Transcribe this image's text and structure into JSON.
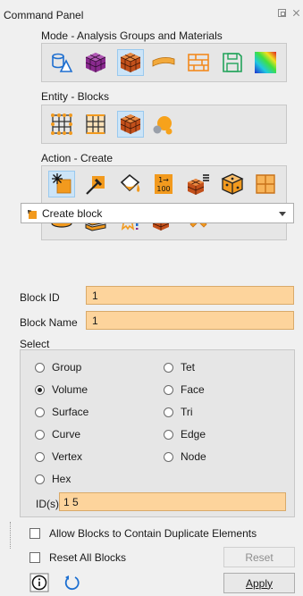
{
  "window": {
    "title": "Command Panel"
  },
  "mode": {
    "label": "Mode - Analysis Groups and Materials",
    "tools": [
      {
        "name": "geometry",
        "icon": "geometry-mode-icon",
        "selected": false
      },
      {
        "name": "mesh",
        "icon": "mesh-mode-icon",
        "selected": false
      },
      {
        "name": "blocks",
        "icon": "blocks-mode-icon",
        "selected": true
      },
      {
        "name": "boundary-conditions",
        "icon": "boundary-conditions-mode-icon",
        "selected": false
      },
      {
        "name": "materials",
        "icon": "materials-mode-icon",
        "selected": false
      },
      {
        "name": "export",
        "icon": "export-mode-icon",
        "selected": false
      },
      {
        "name": "results",
        "icon": "results-colormap-icon",
        "selected": false
      }
    ]
  },
  "entity": {
    "label": "Entity - Blocks",
    "tools": [
      {
        "name": "nodesets",
        "icon": "nodesets-icon",
        "selected": false
      },
      {
        "name": "sidesets",
        "icon": "sidesets-icon",
        "selected": false
      },
      {
        "name": "blocks",
        "icon": "blocks-entity-icon",
        "selected": true
      },
      {
        "name": "groups",
        "icon": "groups-icon",
        "selected": false
      }
    ]
  },
  "action": {
    "label": "Action - Create",
    "row1": [
      {
        "name": "create",
        "icon": "create-block-icon",
        "selected": true
      },
      {
        "name": "modify",
        "icon": "modify-block-icon",
        "selected": false
      },
      {
        "name": "element-type",
        "icon": "element-type-icon",
        "selected": false
      },
      {
        "name": "renumber",
        "icon": "renumber-icon",
        "selected": false,
        "glyph_top": "1→",
        "glyph_bottom": "100"
      },
      {
        "name": "list",
        "icon": "list-blocks-icon",
        "selected": false
      },
      {
        "name": "attributes",
        "icon": "block-attributes-icon",
        "selected": false
      },
      {
        "name": "split",
        "icon": "split-block-icon",
        "selected": false
      }
    ],
    "row2": [
      {
        "name": "cylinder",
        "icon": "cylinder-block-icon",
        "selected": false
      },
      {
        "name": "layers",
        "icon": "layered-block-icon",
        "selected": false
      },
      {
        "name": "properties",
        "icon": "block-properties-icon",
        "selected": false
      },
      {
        "name": "import",
        "icon": "import-block-icon",
        "selected": false
      },
      {
        "name": "delete",
        "icon": "delete-block-icon",
        "selected": false
      }
    ]
  },
  "command": {
    "selected": "Create block"
  },
  "fields": {
    "block_id": {
      "label": "Block ID",
      "value": "1"
    },
    "block_name": {
      "label": "Block Name",
      "value": "1"
    }
  },
  "select": {
    "label": "Select",
    "options_left": [
      {
        "label": "Group",
        "checked": false
      },
      {
        "label": "Volume",
        "checked": true
      },
      {
        "label": "Surface",
        "checked": false
      },
      {
        "label": "Curve",
        "checked": false
      },
      {
        "label": "Vertex",
        "checked": false
      },
      {
        "label": "Hex",
        "checked": false
      }
    ],
    "options_right": [
      {
        "label": "Tet",
        "checked": false
      },
      {
        "label": "Face",
        "checked": false
      },
      {
        "label": "Tri",
        "checked": false
      },
      {
        "label": "Edge",
        "checked": false
      },
      {
        "label": "Node",
        "checked": false
      }
    ],
    "ids_label": "ID(s)",
    "ids_value": "1 5"
  },
  "checkboxes": {
    "allow_duplicates": {
      "label": "Allow Blocks to Contain Duplicate Elements",
      "checked": false
    },
    "reset_all": {
      "label": "Reset All Blocks",
      "checked": false
    }
  },
  "buttons": {
    "reset": "Reset",
    "apply": "Apply"
  },
  "colors": {
    "accent_orange": "#fdd49c",
    "selection_blue": "#cce4f7",
    "panel_bg": "#f0f0f0",
    "group_bg": "#e6e6e6",
    "info_blue": "#1c6fd1"
  }
}
